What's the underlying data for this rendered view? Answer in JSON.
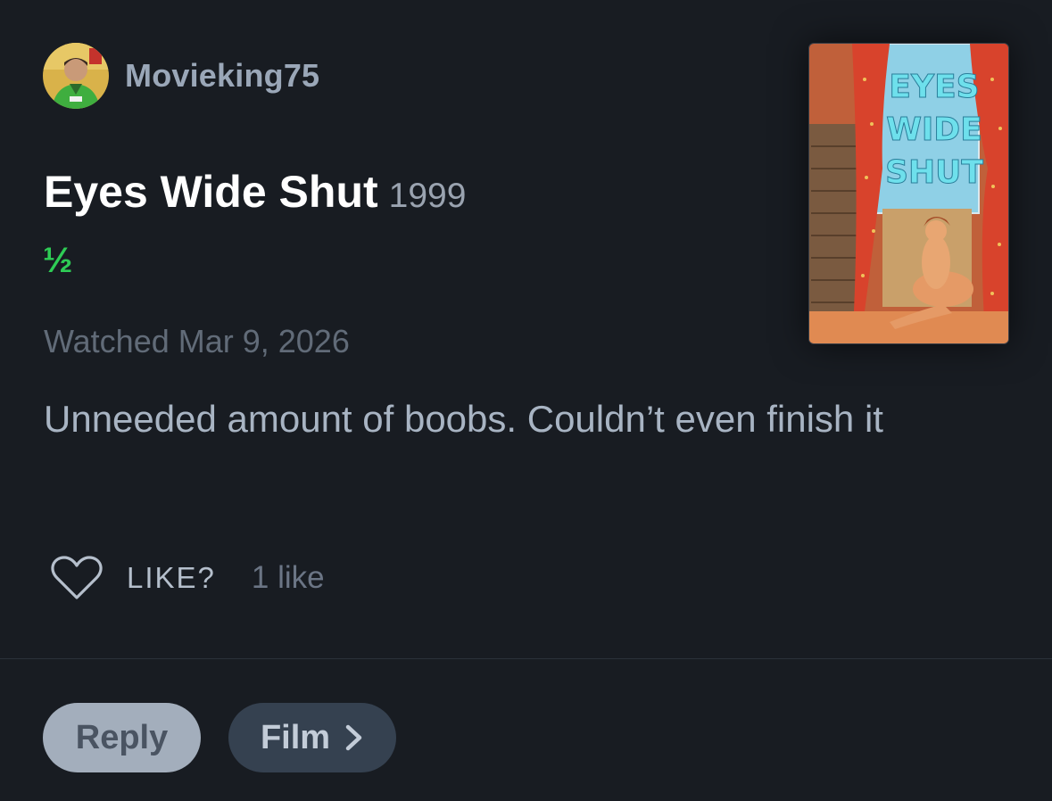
{
  "author": {
    "name": "Movieking75",
    "avatar_icon": "person-avatar"
  },
  "film": {
    "title": "Eyes Wide Shut",
    "year": "1999",
    "rating": "½",
    "rating_color": "#2ecc55"
  },
  "watched": "Watched Mar 9, 2026",
  "review": "Unneeded amount of boobs. Couldn’t even finish it",
  "like": {
    "label": "LIKE?",
    "count": "1 like",
    "icon": "heart-outline-icon"
  },
  "poster": {
    "text_lines": [
      "EYES",
      "WIDE",
      "SHUT"
    ]
  },
  "actions": {
    "reply_label": "Reply",
    "film_label": "Film",
    "film_icon": "chevron-right-icon"
  }
}
